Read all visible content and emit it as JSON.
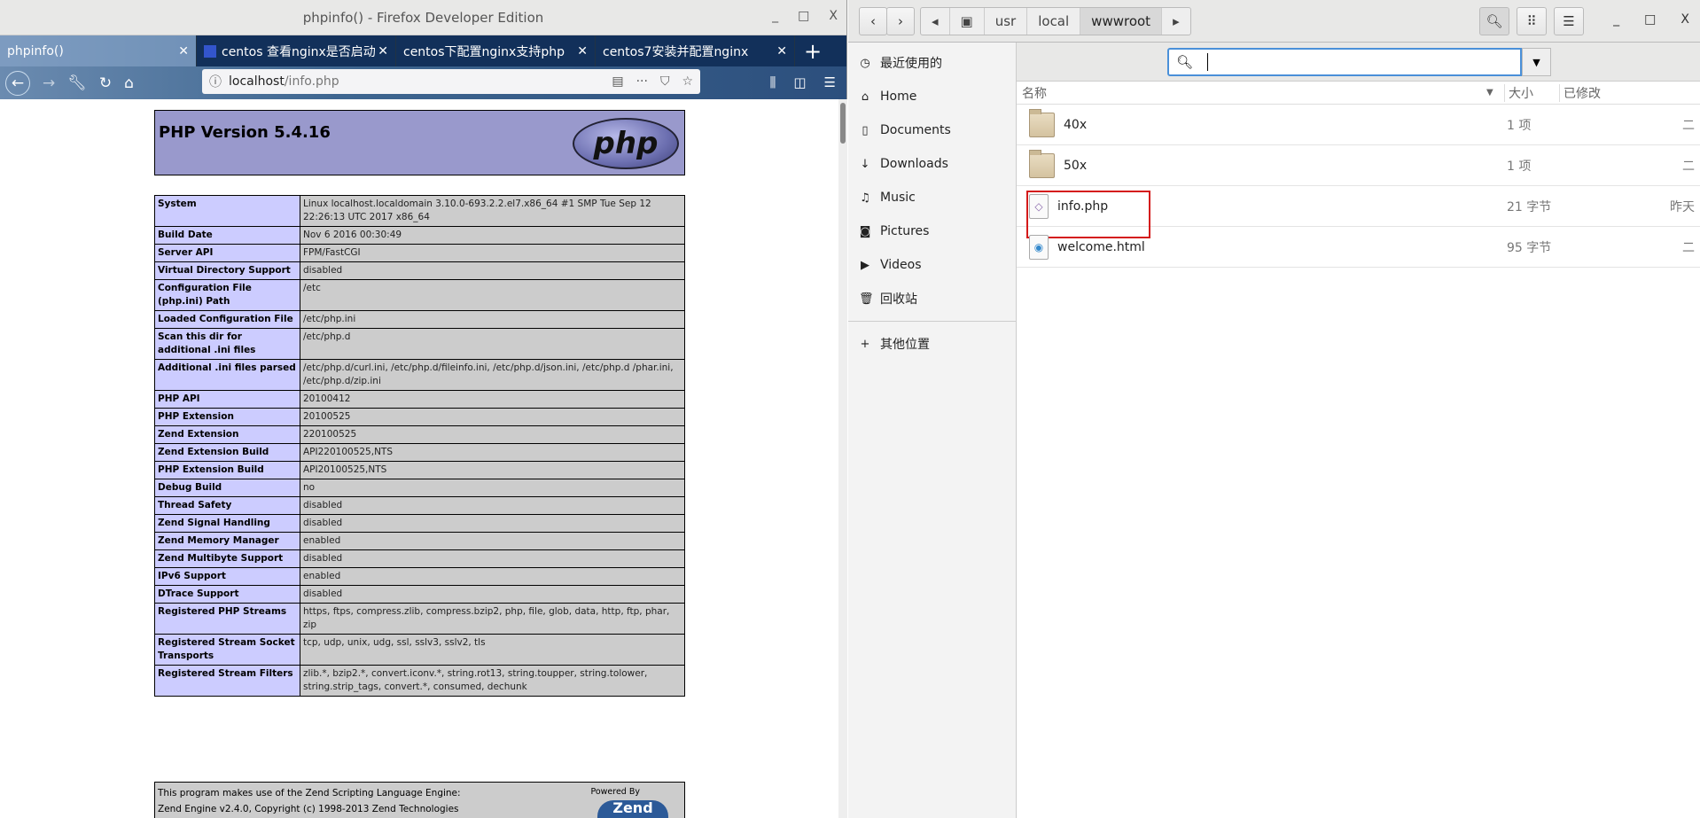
{
  "firefox": {
    "window_title": "phpinfo() - Firefox Developer Edition",
    "window_controls": [
      "_",
      "□",
      "X"
    ],
    "tabs": [
      {
        "label": "phpinfo()",
        "active": true
      },
      {
        "label": "centos 查看nginx是否启动",
        "active": false
      },
      {
        "label": "centos下配置nginx支持php",
        "active": false
      },
      {
        "label": "centos7安装并配置nginx",
        "active": false
      }
    ],
    "new_tab": "+",
    "url_host": "localhost",
    "url_path": "/info.php"
  },
  "phpinfo": {
    "version_title": "PHP Version 5.4.16",
    "logo_text": "php",
    "rows": [
      {
        "k": "System",
        "v": "Linux localhost.localdomain 3.10.0-693.2.2.el7.x86_64 #1 SMP Tue Sep 12 22:26:13 UTC 2017 x86_64"
      },
      {
        "k": "Build Date",
        "v": "Nov 6 2016 00:30:49"
      },
      {
        "k": "Server API",
        "v": "FPM/FastCGI"
      },
      {
        "k": "Virtual Directory Support",
        "v": "disabled"
      },
      {
        "k": "Configuration File (php.ini) Path",
        "v": "/etc"
      },
      {
        "k": "Loaded Configuration File",
        "v": "/etc/php.ini"
      },
      {
        "k": "Scan this dir for additional .ini files",
        "v": "/etc/php.d"
      },
      {
        "k": "Additional .ini files parsed",
        "v": "/etc/php.d/curl.ini, /etc/php.d/fileinfo.ini, /etc/php.d/json.ini, /etc/php.d /phar.ini, /etc/php.d/zip.ini"
      },
      {
        "k": "PHP API",
        "v": "20100412"
      },
      {
        "k": "PHP Extension",
        "v": "20100525"
      },
      {
        "k": "Zend Extension",
        "v": "220100525"
      },
      {
        "k": "Zend Extension Build",
        "v": "API220100525,NTS"
      },
      {
        "k": "PHP Extension Build",
        "v": "API20100525,NTS"
      },
      {
        "k": "Debug Build",
        "v": "no"
      },
      {
        "k": "Thread Safety",
        "v": "disabled"
      },
      {
        "k": "Zend Signal Handling",
        "v": "disabled"
      },
      {
        "k": "Zend Memory Manager",
        "v": "enabled"
      },
      {
        "k": "Zend Multibyte Support",
        "v": "disabled"
      },
      {
        "k": "IPv6 Support",
        "v": "enabled"
      },
      {
        "k": "DTrace Support",
        "v": "disabled"
      },
      {
        "k": "Registered PHP Streams",
        "v": "https, ftps, compress.zlib, compress.bzip2, php, file, glob, data, http, ftp, phar, zip"
      },
      {
        "k": "Registered Stream Socket Transports",
        "v": "tcp, udp, unix, udg, ssl, sslv3, sslv2, tls"
      },
      {
        "k": "Registered Stream Filters",
        "v": "zlib.*, bzip2.*, convert.iconv.*, string.rot13, string.toupper, string.tolower, string.strip_tags, convert.*, consumed, dechunk"
      }
    ],
    "footer_line1": "This program makes use of the Zend Scripting Language Engine:",
    "footer_line2": "Zend Engine v2.4.0, Copyright (c) 1998-2013 Zend Technologies",
    "powered_by": "Powered By",
    "zend_logo_text": "Zend"
  },
  "files": {
    "breadcrumbs": [
      "usr",
      "local",
      "wwwroot"
    ],
    "window_controls": [
      "_",
      "□",
      "X"
    ],
    "sidebar": [
      {
        "label": "最近使用的",
        "icon": "clock-icon"
      },
      {
        "label": "Home",
        "icon": "home-icon"
      },
      {
        "label": "Documents",
        "icon": "document-icon"
      },
      {
        "label": "Downloads",
        "icon": "download-icon"
      },
      {
        "label": "Music",
        "icon": "music-icon"
      },
      {
        "label": "Pictures",
        "icon": "camera-icon"
      },
      {
        "label": "Videos",
        "icon": "video-icon"
      },
      {
        "label": "回收站",
        "icon": "trash-icon"
      }
    ],
    "other_locations": "其他位置",
    "search_value": "",
    "columns": {
      "name": "名称",
      "size": "大小",
      "modified": "已修改"
    },
    "rows": [
      {
        "name": "40x",
        "size": "1 项",
        "modified": "二",
        "type": "folder"
      },
      {
        "name": "50x",
        "size": "1 项",
        "modified": "二",
        "type": "folder"
      },
      {
        "name": "info.php",
        "size": "21 字节",
        "modified": "昨天",
        "type": "php",
        "highlighted": true
      },
      {
        "name": "welcome.html",
        "size": "95 字节",
        "modified": "二",
        "type": "html"
      }
    ],
    "highlight_color": "#d41a1a"
  }
}
